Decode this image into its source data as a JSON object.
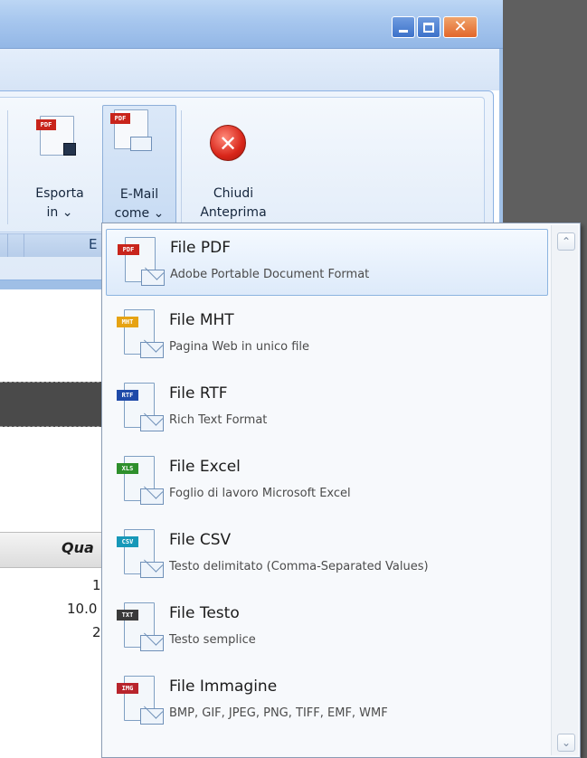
{
  "window": {
    "min_glyph": "",
    "close_glyph": "✕"
  },
  "ribbon": {
    "group_label_fragment": "E",
    "buttons": [
      {
        "label_line1": "Esporta",
        "label_line2": "in ⌄",
        "badge": "PDF"
      },
      {
        "label_line1": "E-Mail",
        "label_line2": "come ⌄",
        "badge": "PDF"
      },
      {
        "label_line1": "Chiudi",
        "label_line2": "Anteprima"
      }
    ]
  },
  "document": {
    "column_header_fragment": "Qua",
    "values": [
      "1",
      "10.0",
      "2"
    ]
  },
  "menu": {
    "items": [
      {
        "title": "File PDF",
        "desc": "Adobe Portable Document Format",
        "badge": "PDF",
        "badge_color": "#c8241b"
      },
      {
        "title": "File MHT",
        "desc": "Pagina Web in unico file",
        "badge": "MHT",
        "badge_color": "#e6a313"
      },
      {
        "title": "File RTF",
        "desc": "Rich Text Format",
        "badge": "RTF",
        "badge_color": "#1f4aa8"
      },
      {
        "title": "File Excel",
        "desc": "Foglio di lavoro Microsoft Excel",
        "badge": "XLS",
        "badge_color": "#2e8f2c"
      },
      {
        "title": "File CSV",
        "desc": "Testo delimitato (Comma-Separated Values)",
        "badge": "CSV",
        "badge_color": "#1798b8"
      },
      {
        "title": "File Testo",
        "desc": "Testo semplice",
        "badge": "TXT",
        "badge_color": "#3a3a3a"
      },
      {
        "title": "File Immagine",
        "desc": "BMP, GIF, JPEG, PNG, TIFF, EMF, WMF",
        "badge": "IMG",
        "badge_color": "#b8242c"
      }
    ],
    "scroll_up": "⌃",
    "scroll_down": "⌄"
  }
}
